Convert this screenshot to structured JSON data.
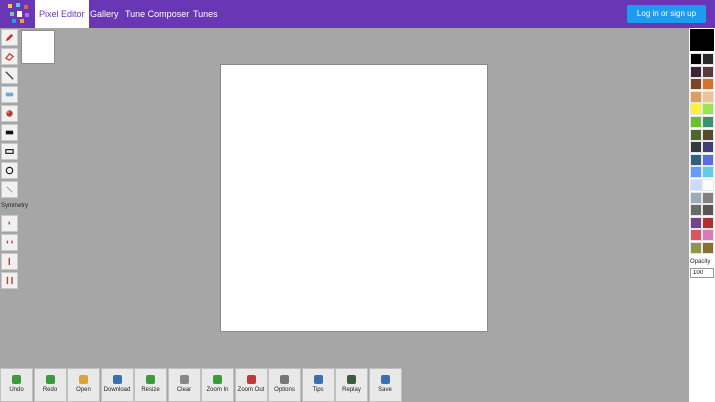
{
  "nav": {
    "tabs": [
      {
        "label": "Pixel Editor",
        "active": true
      },
      {
        "label": "Gallery",
        "active": false
      },
      {
        "label": "Tune Composer",
        "active": false
      },
      {
        "label": "Tunes",
        "active": false
      }
    ],
    "login_label": "Log in or sign up"
  },
  "tools": {
    "items": [
      "pencil-icon",
      "eraser-icon",
      "line-icon",
      "rectangle-icon",
      "fill-icon",
      "filled-rectangle-icon",
      "rectangle-outline-icon",
      "circle-icon",
      "dither-icon"
    ],
    "symmetry_label": "Symmetry",
    "symmetry_items": [
      "none",
      "vertical",
      "horizontal",
      "both"
    ]
  },
  "palette": {
    "selected": "#000000",
    "colors": [
      "#000000",
      "#2a2a2a",
      "#3a2535",
      "#5b3a3a",
      "#7a4528",
      "#d4722e",
      "#d9a066",
      "#eec39a",
      "#fbf236",
      "#99e550",
      "#6abe30",
      "#37946e",
      "#4b692f",
      "#524b24",
      "#323c39",
      "#3f3f74",
      "#306082",
      "#5b6ee1",
      "#639bff",
      "#5fcde4",
      "#cbdbfc",
      "#ffffff",
      "#9badb7",
      "#847e87",
      "#696a6a",
      "#595652",
      "#76428a",
      "#ac3232",
      "#d95763",
      "#d77bba",
      "#8f974a",
      "#8a6f30"
    ],
    "opacity_label": "Opacity",
    "opacity_value": "100"
  },
  "bottom": {
    "buttons": [
      {
        "label": "Undo",
        "icon": "undo-icon",
        "color": "#3c9a3c"
      },
      {
        "label": "Redo",
        "icon": "redo-icon",
        "color": "#3c9a3c"
      },
      {
        "label": "Open",
        "icon": "open-icon",
        "color": "#d9a53a"
      },
      {
        "label": "Download",
        "icon": "download-icon",
        "color": "#3a6fb0"
      },
      {
        "label": "Resize",
        "icon": "resize-icon",
        "color": "#3c9a3c"
      },
      {
        "label": "Clear",
        "icon": "clear-icon",
        "color": "#888888"
      },
      {
        "label": "Zoom In",
        "icon": "zoom-in-icon",
        "color": "#3c9a3c"
      },
      {
        "label": "Zoom Out",
        "icon": "zoom-out-icon",
        "color": "#c03a3a"
      },
      {
        "label": "Options",
        "icon": "options-icon",
        "color": "#777777"
      },
      {
        "label": "Tips",
        "icon": "tips-icon",
        "color": "#3a6fb0"
      },
      {
        "label": "Replay",
        "icon": "replay-icon",
        "color": "#3c5a3c"
      },
      {
        "label": "Save",
        "icon": "save-icon",
        "color": "#3a6fb0"
      }
    ]
  }
}
